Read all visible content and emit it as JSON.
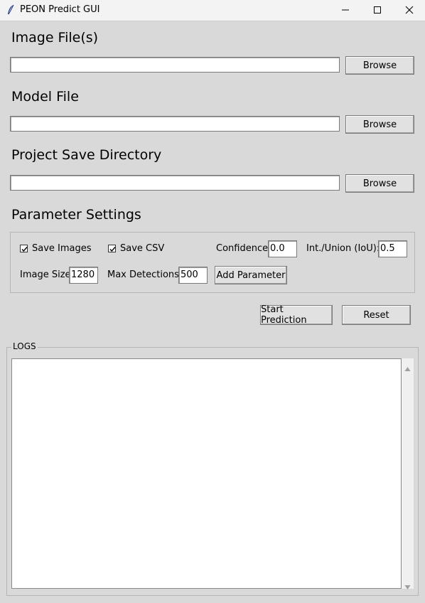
{
  "window": {
    "title": "PEON Predict GUI",
    "icon": "feather-icon",
    "controls": [
      "minimize-icon",
      "maximize-icon",
      "close-icon"
    ]
  },
  "sections": {
    "image_files": {
      "title": "Image File(s)",
      "value": "",
      "browse_label": "Browse"
    },
    "model_file": {
      "title": "Model File",
      "value": "",
      "browse_label": "Browse"
    },
    "project_dir": {
      "title": "Project Save Directory",
      "value": "",
      "browse_label": "Browse"
    }
  },
  "parameters": {
    "title": "Parameter Settings",
    "save_images": {
      "label": "Save Images",
      "checked": true
    },
    "save_csv": {
      "label": "Save CSV",
      "checked": true
    },
    "confidence": {
      "label": "Confidence:",
      "value": "0.0"
    },
    "iou": {
      "label": "Int./Union (IoU):",
      "value": "0.5"
    },
    "image_size": {
      "label": "Image Size:",
      "value": "1280"
    },
    "max_detections": {
      "label": "Max Detections:",
      "value": "500"
    },
    "add_parameter_label": "Add Parameter"
  },
  "actions": {
    "start_label": "Start Prediction",
    "reset_label": "Reset"
  },
  "logs": {
    "label": "LOGS",
    "content": ""
  }
}
